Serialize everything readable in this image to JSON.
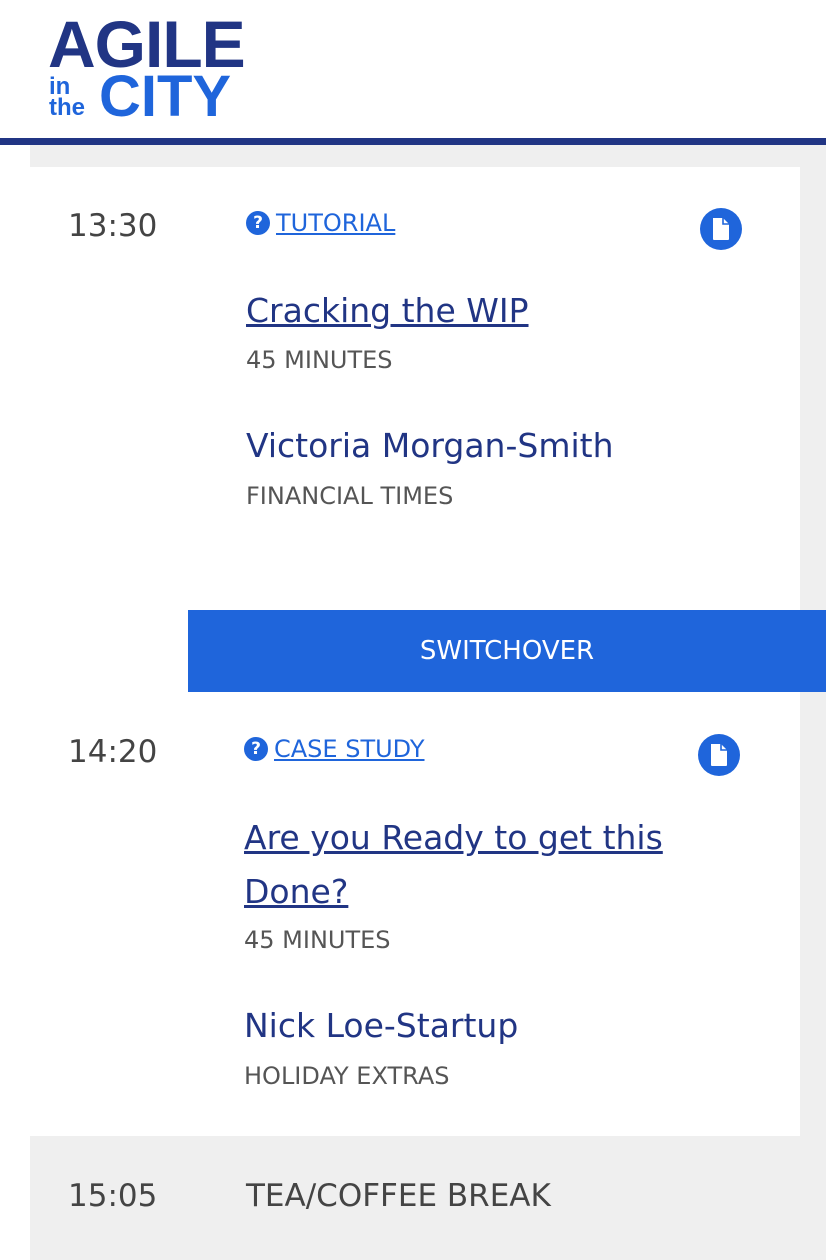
{
  "brand": {
    "line1": "AGILE",
    "small_in": "in",
    "small_the": "the",
    "line2": "CITY",
    "colors": {
      "navy": "#213584",
      "blue": "#1f65db",
      "grey": "#efefef"
    }
  },
  "sessions": [
    {
      "time": "13:30",
      "type_label": " TUTORIAL",
      "type_icon": "question-circle-icon",
      "doc_icon": "document-icon",
      "title": "Cracking the WIP",
      "duration": "45 MINUTES",
      "speaker": "Victoria Morgan-Smith",
      "company": "FINANCIAL TIMES"
    },
    {
      "time": "14:20",
      "type_label": " CASE STUDY",
      "type_icon": "question-circle-icon",
      "doc_icon": "document-icon",
      "title": "Are you Ready to get this Done?",
      "duration": "45 MINUTES",
      "speaker": "Nick Loe-Startup",
      "company": "HOLIDAY EXTRAS"
    }
  ],
  "switchover": {
    "label": "SWITCHOVER"
  },
  "break": {
    "time": "15:05",
    "label": "TEA/COFFEE BREAK"
  }
}
